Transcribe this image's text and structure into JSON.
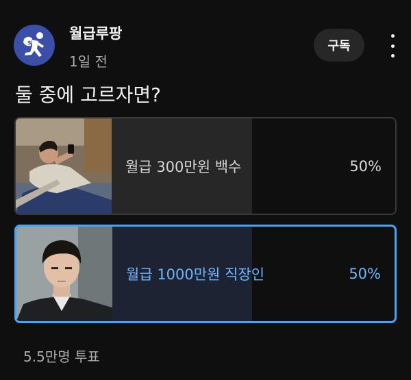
{
  "channel": {
    "name": "월급루팡",
    "time": "1일 전",
    "subscribe_label": "구독"
  },
  "post": {
    "question": "둘 중에 고르자면?"
  },
  "poll": {
    "options": [
      {
        "label": "월급 300만원 백수",
        "percent_text": "50%",
        "share": 0.5,
        "selected": false
      },
      {
        "label": "월급 1000만원 직장인",
        "percent_text": "50%",
        "share": 0.5,
        "selected": true
      }
    ],
    "vote_count": "5.5만명 투표"
  },
  "colors": {
    "accent": "#3ea6ff",
    "avatar_bg": "#3b4fa8",
    "background": "#0f0f0f"
  },
  "icons": {
    "avatar": "running-thief-icon",
    "more": "more-vertical-icon"
  }
}
